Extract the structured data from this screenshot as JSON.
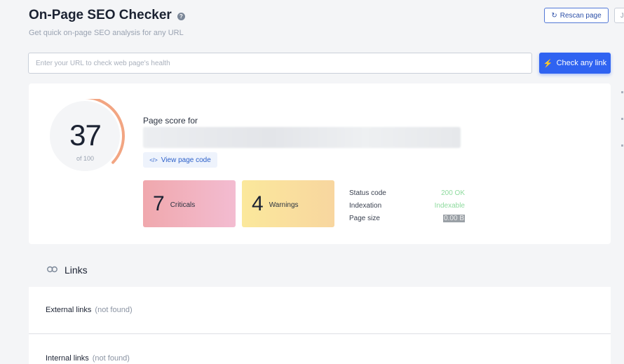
{
  "header": {
    "title": "On-Page SEO Checker",
    "help_icon": "?",
    "subtitle": "Get quick on-page SEO analysis for any URL",
    "rescan_label": "Rescan page",
    "rescan_icon": "↻",
    "extra_button_label": "J"
  },
  "search": {
    "placeholder": "Enter your URL to check web page's health",
    "value": "",
    "button_label": "Check any link",
    "button_icon": "⚡"
  },
  "score": {
    "value": 37,
    "max_label": "of 100",
    "fraction": 0.37,
    "page_score_label": "Page score for",
    "view_code_label": "View page code",
    "view_code_icon": "</>"
  },
  "metrics": {
    "criticals": {
      "count": "7",
      "label": "Criticals"
    },
    "warnings": {
      "count": "4",
      "label": "Warnings"
    }
  },
  "stats": [
    {
      "label": "Status code",
      "value": "200 OK"
    },
    {
      "label": "Indexation",
      "value": "Indexable"
    },
    {
      "label": "Page size",
      "value": "0.00 B"
    }
  ],
  "links": {
    "title": "Links",
    "icon": "🔗",
    "external_label": "External links",
    "external_status": "(not found)",
    "internal_label": "Internal links",
    "internal_status": "(not found)"
  },
  "colors": {
    "accent": "#2f63f1",
    "gauge_stroke": "#f2a582",
    "critical": "#f0a8ad",
    "warning": "#fbe89c",
    "success": "#8fdb9f"
  }
}
